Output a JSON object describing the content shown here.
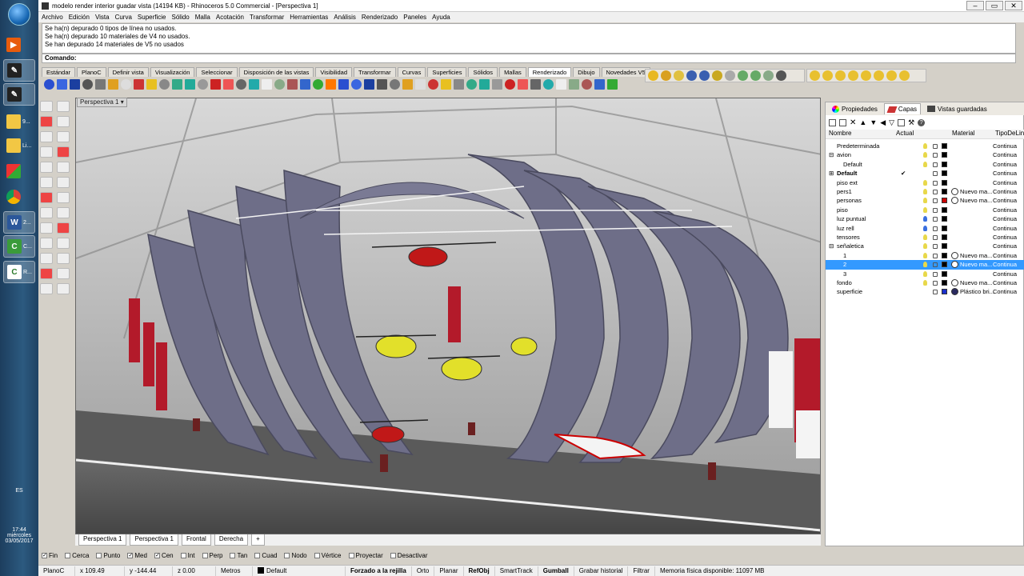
{
  "window": {
    "title": "modelo render interior guadar vista (14194 KB) - Rhinoceros 5.0 Commercial - [Perspectiva 1]"
  },
  "menu": [
    "Archivo",
    "Edición",
    "Vista",
    "Curva",
    "Superficie",
    "Sólido",
    "Malla",
    "Acotación",
    "Transformar",
    "Herramientas",
    "Análisis",
    "Renderizado",
    "Paneles",
    "Ayuda"
  ],
  "history": [
    "Se ha(n) depurado 0 tipos de línea no usados.",
    "Se ha(n) depurado 10 materiales de V4 no usados.",
    "Se han depurado 14 materiales de V5 no usados"
  ],
  "command": {
    "label": "Comando:"
  },
  "toolbar_tabs": [
    "Estándar",
    "PlanoC",
    "Definir vista",
    "Visualización",
    "Seleccionar",
    "Disposición de las vistas",
    "Visibilidad",
    "Transformar",
    "Curvas",
    "Superficies",
    "Sólidos",
    "Mallas",
    "Renderizado",
    "Dibujo",
    "Novedades V5"
  ],
  "selected_toolbar_tab": "Renderizado",
  "viewport": {
    "label": "Perspectiva 1"
  },
  "viewport_tabs": [
    "Perspectiva 1",
    "Perspectiva 1",
    "Frontal",
    "Derecha"
  ],
  "panel": {
    "tabs": [
      "Propiedades",
      "Capas",
      "Vistas guardadas"
    ],
    "columns": {
      "name": "Nombre",
      "current": "Actual",
      "material": "Material",
      "linetype": "TipoDeLin"
    },
    "layers": [
      {
        "name": "Predeterminada",
        "indent": 1,
        "exp": "",
        "check": "",
        "color": "#000000",
        "mat": "",
        "matname": "",
        "lt": "Continua",
        "bulb": "y",
        "sel": false,
        "bold": false
      },
      {
        "name": "avion",
        "indent": 1,
        "exp": "⊟",
        "check": "",
        "color": "#000000",
        "mat": "",
        "matname": "",
        "lt": "Continua",
        "bulb": "y",
        "sel": false,
        "bold": false
      },
      {
        "name": "Default",
        "indent": 2,
        "exp": "",
        "check": "",
        "color": "#000000",
        "mat": "",
        "matname": "",
        "lt": "Continua",
        "bulb": "y",
        "sel": false,
        "bold": false
      },
      {
        "name": "Default",
        "indent": 1,
        "exp": "⊞",
        "check": "✔",
        "color": "#000000",
        "mat": "",
        "matname": "",
        "lt": "Continua",
        "bulb": "",
        "sel": false,
        "bold": true
      },
      {
        "name": "piso ext",
        "indent": 1,
        "exp": "",
        "check": "",
        "color": "#000000",
        "mat": "",
        "matname": "",
        "lt": "Continua",
        "bulb": "y",
        "sel": false,
        "bold": false
      },
      {
        "name": "pers1",
        "indent": 1,
        "exp": "",
        "check": "",
        "color": "#000000",
        "mat": "#ffffff",
        "matname": "Nuevo ma...",
        "lt": "Continua",
        "bulb": "y",
        "sel": false,
        "bold": false
      },
      {
        "name": "personas",
        "indent": 1,
        "exp": "",
        "check": "",
        "color": "#cc0000",
        "mat": "#ffffff",
        "matname": "Nuevo ma...",
        "lt": "Continua",
        "bulb": "y",
        "sel": false,
        "bold": false
      },
      {
        "name": "piso",
        "indent": 1,
        "exp": "",
        "check": "",
        "color": "#000000",
        "mat": "",
        "matname": "",
        "lt": "Continua",
        "bulb": "y",
        "sel": false,
        "bold": false
      },
      {
        "name": "luz puntual",
        "indent": 1,
        "exp": "",
        "check": "",
        "color": "#000000",
        "mat": "",
        "matname": "",
        "lt": "Continua",
        "bulb": "b",
        "sel": false,
        "bold": false
      },
      {
        "name": "luz rell",
        "indent": 1,
        "exp": "",
        "check": "",
        "color": "#000000",
        "mat": "",
        "matname": "",
        "lt": "Continua",
        "bulb": "b",
        "sel": false,
        "bold": false
      },
      {
        "name": "tensores",
        "indent": 1,
        "exp": "",
        "check": "",
        "color": "#000000",
        "mat": "",
        "matname": "",
        "lt": "Continua",
        "bulb": "y",
        "sel": false,
        "bold": false
      },
      {
        "name": "señaletica",
        "indent": 1,
        "exp": "⊟",
        "check": "",
        "color": "#000000",
        "mat": "",
        "matname": "",
        "lt": "Continua",
        "bulb": "y",
        "sel": false,
        "bold": false
      },
      {
        "name": "1",
        "indent": 2,
        "exp": "",
        "check": "",
        "color": "#000000",
        "mat": "#ffffff",
        "matname": "Nuevo ma...",
        "lt": "Continua",
        "bulb": "y",
        "sel": false,
        "bold": false
      },
      {
        "name": "2",
        "indent": 2,
        "exp": "",
        "check": "",
        "color": "#000000",
        "mat": "#ffffff",
        "matname": "Nuevo ma...",
        "lt": "Continua",
        "bulb": "y",
        "sel": true,
        "bold": false
      },
      {
        "name": "3",
        "indent": 2,
        "exp": "",
        "check": "",
        "color": "#000000",
        "mat": "",
        "matname": "",
        "lt": "Continua",
        "bulb": "y",
        "sel": false,
        "bold": false
      },
      {
        "name": "fondo",
        "indent": 1,
        "exp": "",
        "check": "",
        "color": "#000000",
        "mat": "#ffffff",
        "matname": "Nuevo ma...",
        "lt": "Continua",
        "bulb": "y",
        "sel": false,
        "bold": false
      },
      {
        "name": "superficie",
        "indent": 1,
        "exp": "",
        "check": "",
        "color": "#1a2fcc",
        "mat": "#2a2a60",
        "matname": "Plástico bri...",
        "lt": "Continua",
        "bulb": "",
        "sel": false,
        "bold": false
      }
    ]
  },
  "osnap": [
    {
      "label": "Fin",
      "on": true
    },
    {
      "label": "Cerca",
      "on": false
    },
    {
      "label": "Punto",
      "on": false
    },
    {
      "label": "Med",
      "on": true
    },
    {
      "label": "Cen",
      "on": true
    },
    {
      "label": "Int",
      "on": false
    },
    {
      "label": "Perp",
      "on": false
    },
    {
      "label": "Tan",
      "on": false
    },
    {
      "label": "Cuad",
      "on": false
    },
    {
      "label": "Nodo",
      "on": false
    },
    {
      "label": "Vértice",
      "on": false
    },
    {
      "label": "Proyectar",
      "on": false
    },
    {
      "label": "Desactivar",
      "on": false
    }
  ],
  "status": {
    "cplane": "PlanoC",
    "x": "x 109.49",
    "y": "y -144.44",
    "z": "z 0.00",
    "units": "Metros",
    "layer": "Default",
    "toggles": [
      {
        "label": "Forzado a la rejilla",
        "bold": true
      },
      {
        "label": "Orto",
        "bold": false
      },
      {
        "label": "Planar",
        "bold": false
      },
      {
        "label": "RefObj",
        "bold": true
      },
      {
        "label": "SmartTrack",
        "bold": false
      },
      {
        "label": "Gumball",
        "bold": true
      },
      {
        "label": "Grabar historial",
        "bold": false
      },
      {
        "label": "Filtrar",
        "bold": false
      }
    ],
    "memory": "Memoria física disponible: 11097 MB"
  },
  "taskbar": {
    "items": [
      "9...",
      "Li...",
      "2...",
      "C...",
      "R..."
    ],
    "lang": "ES",
    "time": "17:44",
    "day": "miércoles",
    "date": "03/05/2017"
  }
}
